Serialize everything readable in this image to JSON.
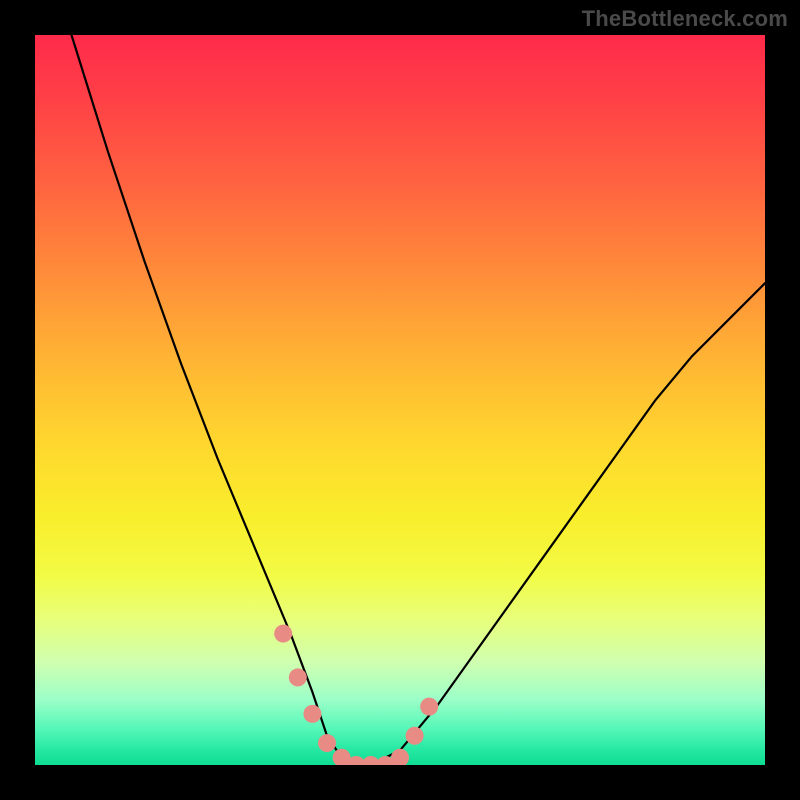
{
  "watermark": "TheBottleneck.com",
  "chart_data": {
    "type": "line",
    "title": "",
    "xlabel": "",
    "ylabel": "",
    "xlim": [
      0,
      100
    ],
    "ylim": [
      0,
      100
    ],
    "grid": false,
    "legend": false,
    "series": [
      {
        "name": "bottleneck-curve",
        "x": [
          5,
          10,
          15,
          20,
          25,
          30,
          35,
          38,
          40,
          42,
          44,
          46,
          50,
          55,
          60,
          65,
          70,
          75,
          80,
          85,
          90,
          95,
          100
        ],
        "y": [
          100,
          84,
          69,
          55,
          42,
          30,
          18,
          10,
          4,
          1,
          0,
          0,
          2,
          8,
          15,
          22,
          29,
          36,
          43,
          50,
          56,
          61,
          66
        ]
      }
    ],
    "markers": [
      {
        "name": "highlight-dots",
        "color": "#e98b85",
        "x": [
          34,
          36,
          38,
          40,
          42,
          44,
          46,
          48,
          50,
          52,
          54
        ],
        "y": [
          18,
          12,
          7,
          3,
          1,
          0,
          0,
          0,
          1,
          4,
          8
        ]
      }
    ],
    "background_gradient": {
      "stops": [
        {
          "pos": 0,
          "color": "#ff2a4a"
        },
        {
          "pos": 50,
          "color": "#ffd72e"
        },
        {
          "pos": 80,
          "color": "#e8ff7a"
        },
        {
          "pos": 100,
          "color": "#0fdc93"
        }
      ]
    }
  }
}
